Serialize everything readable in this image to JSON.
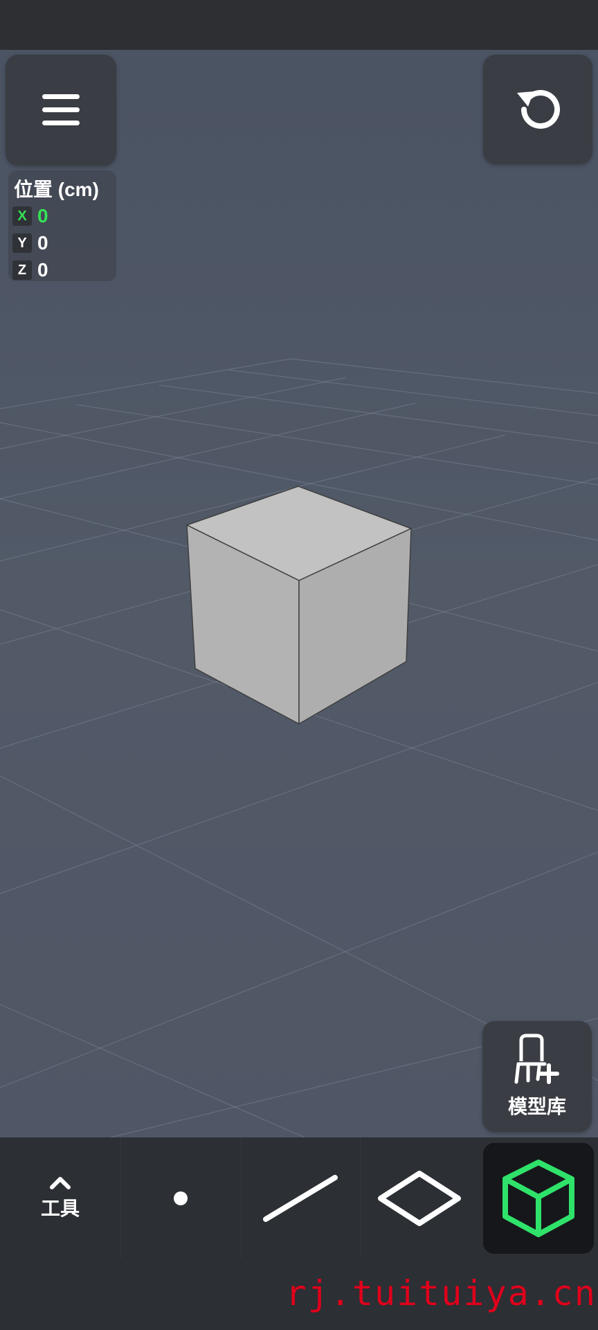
{
  "app": {
    "accent_color": "#35e255",
    "background_color": "#4f5766"
  },
  "header": {
    "menu_icon": "hamburger-menu-icon",
    "undo_icon": "undo-icon"
  },
  "position_panel": {
    "title": "位置 (cm)",
    "axes": [
      {
        "label": "X",
        "value": "0",
        "active": true
      },
      {
        "label": "Y",
        "value": "0",
        "active": false
      },
      {
        "label": "Z",
        "value": "0",
        "active": false
      }
    ]
  },
  "model_library": {
    "label": "模型库",
    "icon": "chair-add-icon"
  },
  "toolbar": {
    "tools_label": "工具",
    "tools_icon": "chevron-up-icon",
    "items": [
      {
        "name": "point",
        "icon": "point-icon"
      },
      {
        "name": "line",
        "icon": "line-icon"
      },
      {
        "name": "plane",
        "icon": "plane-icon"
      },
      {
        "name": "cube",
        "icon": "cube-icon",
        "selected": true
      }
    ]
  },
  "watermark": "rj.tuituiya.cn"
}
